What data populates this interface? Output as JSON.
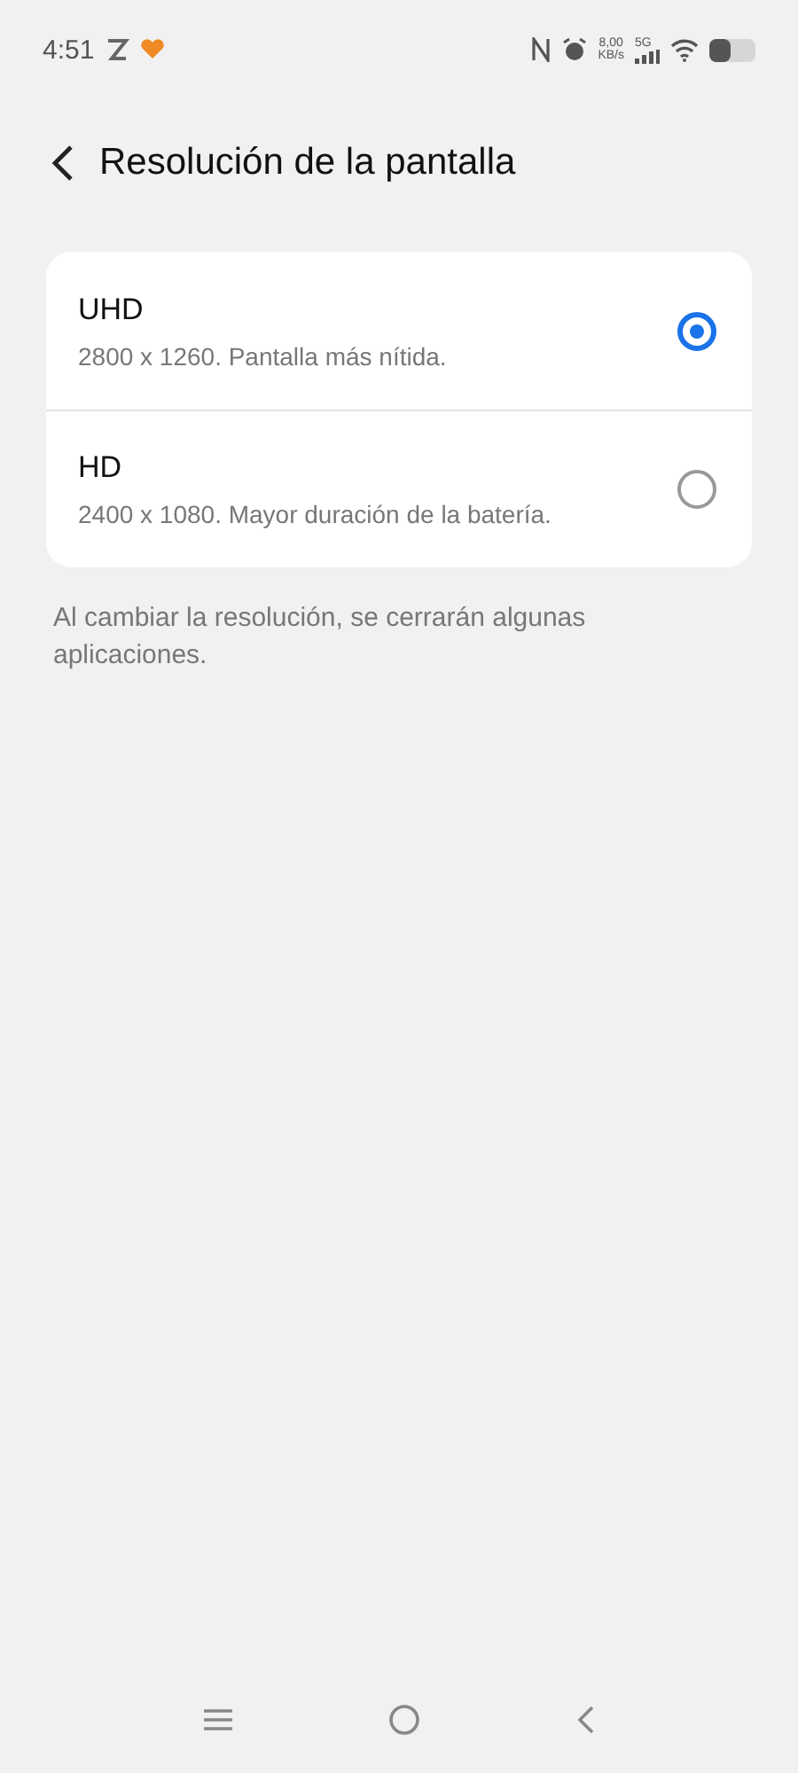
{
  "status_bar": {
    "time": "4:51",
    "speed_value": "8,00",
    "speed_unit": "KB/s",
    "network": "5G"
  },
  "header": {
    "title": "Resolución de la pantalla"
  },
  "options": [
    {
      "title": "UHD",
      "description": "2800 x 1260. Pantalla más nítida.",
      "selected": true
    },
    {
      "title": "HD",
      "description": "2400 x 1080. Mayor duración de la batería.",
      "selected": false
    }
  ],
  "note": "Al cambiar la resolución, se cerrarán algunas aplicaciones."
}
